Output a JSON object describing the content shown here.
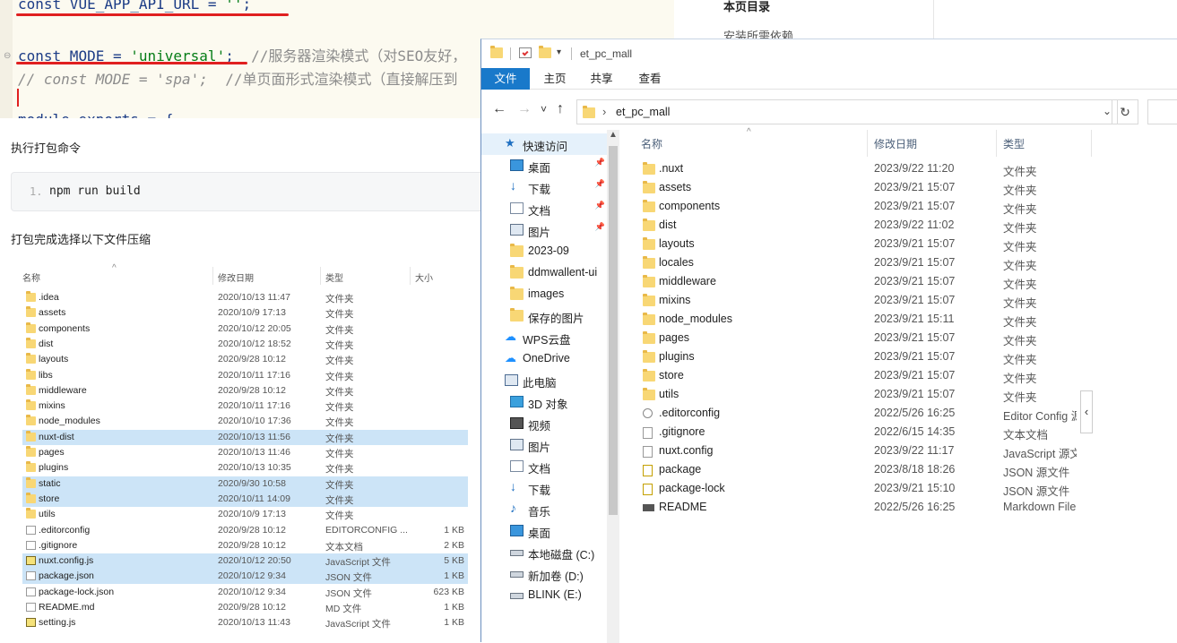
{
  "code": {
    "line1_kw": "const",
    "line1_rest": " VUE_APP_API_URL = ",
    "line1_str": "''",
    "line1_end": ";",
    "line2_kw": "const",
    "line2_rest": " MODE = ",
    "line2_str": "'universal'",
    "line2_end": ";",
    "line2_comment": "  //服务器渲染模式（对SEO友好，",
    "line3_comment": "// const MODE = 'spa';  ",
    "line3_comment2": "//单页面形式渲染模式（直接解压到",
    "line5_partial": "module.exports = {"
  },
  "doc": {
    "build_heading": "执行打包命令",
    "code_line_no": "1.",
    "code_cmd": "npm run build",
    "zip_heading": "打包完成选择以下文件压缩"
  },
  "toc": {
    "title": "本页目录",
    "item1": "安装所需依赖"
  },
  "edge_char": "选",
  "small_explorer": {
    "headers": {
      "name": "名称",
      "date": "修改日期",
      "type": "类型",
      "size": "大小"
    },
    "rows": [
      {
        "name": ".idea",
        "date": "2020/10/13 11:47",
        "type": "文件夹",
        "size": "",
        "icon": "folder",
        "selected": false
      },
      {
        "name": "assets",
        "date": "2020/10/9 17:13",
        "type": "文件夹",
        "size": "",
        "icon": "folder",
        "selected": false
      },
      {
        "name": "components",
        "date": "2020/10/12 20:05",
        "type": "文件夹",
        "size": "",
        "icon": "folder",
        "selected": false
      },
      {
        "name": "dist",
        "date": "2020/10/12 18:52",
        "type": "文件夹",
        "size": "",
        "icon": "folder",
        "selected": false
      },
      {
        "name": "layouts",
        "date": "2020/9/28 10:12",
        "type": "文件夹",
        "size": "",
        "icon": "folder",
        "selected": false
      },
      {
        "name": "libs",
        "date": "2020/10/11 17:16",
        "type": "文件夹",
        "size": "",
        "icon": "folder",
        "selected": false
      },
      {
        "name": "middleware",
        "date": "2020/9/28 10:12",
        "type": "文件夹",
        "size": "",
        "icon": "folder",
        "selected": false
      },
      {
        "name": "mixins",
        "date": "2020/10/11 17:16",
        "type": "文件夹",
        "size": "",
        "icon": "folder",
        "selected": false
      },
      {
        "name": "node_modules",
        "date": "2020/10/10 17:36",
        "type": "文件夹",
        "size": "",
        "icon": "folder",
        "selected": false
      },
      {
        "name": "nuxt-dist",
        "date": "2020/10/13 11:56",
        "type": "文件夹",
        "size": "",
        "icon": "folder",
        "selected": true
      },
      {
        "name": "pages",
        "date": "2020/10/13 11:46",
        "type": "文件夹",
        "size": "",
        "icon": "folder",
        "selected": false
      },
      {
        "name": "plugins",
        "date": "2020/10/13 10:35",
        "type": "文件夹",
        "size": "",
        "icon": "folder",
        "selected": false
      },
      {
        "name": "static",
        "date": "2020/9/30 10:58",
        "type": "文件夹",
        "size": "",
        "icon": "folder",
        "selected": true
      },
      {
        "name": "store",
        "date": "2020/10/11 14:09",
        "type": "文件夹",
        "size": "",
        "icon": "folder",
        "selected": true
      },
      {
        "name": "utils",
        "date": "2020/10/9 17:13",
        "type": "文件夹",
        "size": "",
        "icon": "folder",
        "selected": false
      },
      {
        "name": ".editorconfig",
        "date": "2020/9/28 10:12",
        "type": "EDITORCONFIG ...",
        "size": "1 KB",
        "icon": "file",
        "selected": false
      },
      {
        "name": ".gitignore",
        "date": "2020/9/28 10:12",
        "type": "文本文档",
        "size": "2 KB",
        "icon": "file",
        "selected": false
      },
      {
        "name": "nuxt.config.js",
        "date": "2020/10/12 20:50",
        "type": "JavaScript 文件",
        "size": "5 KB",
        "icon": "js",
        "selected": true
      },
      {
        "name": "package.json",
        "date": "2020/10/12 9:34",
        "type": "JSON 文件",
        "size": "1 KB",
        "icon": "file",
        "selected": true
      },
      {
        "name": "package-lock.json",
        "date": "2020/10/12 9:34",
        "type": "JSON 文件",
        "size": "623 KB",
        "icon": "file",
        "selected": false
      },
      {
        "name": "README.md",
        "date": "2020/9/28 10:12",
        "type": "MD 文件",
        "size": "1 KB",
        "icon": "file",
        "selected": false
      },
      {
        "name": "setting.js",
        "date": "2020/10/13 11:43",
        "type": "JavaScript 文件",
        "size": "1 KB",
        "icon": "js",
        "selected": false
      }
    ]
  },
  "explorer": {
    "title": "et_pc_mall",
    "ribbon_tabs": [
      "文件",
      "主页",
      "共享",
      "查看"
    ],
    "address": "et_pc_mall",
    "back_icon": "←",
    "forward_icon": "→",
    "recent_icon": "˅",
    "up_icon": "↑",
    "dropdown_icon": "⌄",
    "refresh_icon": "↻",
    "columns": {
      "name": "名称",
      "date": "修改日期",
      "type": "类型"
    },
    "sort_arrow": "^",
    "collapse_icon": "‹",
    "nav": [
      {
        "label": "快速访问",
        "icon": "star",
        "pinned": false,
        "indent": 1,
        "highlight": true
      },
      {
        "label": "桌面",
        "icon": "desktop",
        "pinned": true,
        "indent": 2,
        "highlight": false
      },
      {
        "label": "下载",
        "icon": "download",
        "pinned": true,
        "indent": 2,
        "highlight": false
      },
      {
        "label": "文档",
        "icon": "document",
        "pinned": true,
        "indent": 2,
        "highlight": false
      },
      {
        "label": "图片",
        "icon": "picture",
        "pinned": true,
        "indent": 2,
        "highlight": false
      },
      {
        "label": "2023-09",
        "icon": "folder",
        "pinned": false,
        "indent": 2,
        "highlight": false
      },
      {
        "label": "ddmwallent-ui",
        "icon": "folder",
        "pinned": false,
        "indent": 2,
        "highlight": false
      },
      {
        "label": "images",
        "icon": "folder",
        "pinned": false,
        "indent": 2,
        "highlight": false
      },
      {
        "label": "保存的图片",
        "icon": "folder",
        "pinned": false,
        "indent": 2,
        "highlight": false
      },
      {
        "label": "WPS云盘",
        "icon": "cloud",
        "pinned": false,
        "indent": 1,
        "highlight": false
      },
      {
        "label": "OneDrive",
        "icon": "cloud",
        "pinned": false,
        "indent": 1,
        "highlight": false
      },
      {
        "label": "此电脑",
        "icon": "pc",
        "pinned": false,
        "indent": 1,
        "highlight": false
      },
      {
        "label": "3D 对象",
        "icon": "cube",
        "pinned": false,
        "indent": 2,
        "highlight": false
      },
      {
        "label": "视频",
        "icon": "video",
        "pinned": false,
        "indent": 2,
        "highlight": false
      },
      {
        "label": "图片",
        "icon": "picture",
        "pinned": false,
        "indent": 2,
        "highlight": false
      },
      {
        "label": "文档",
        "icon": "document",
        "pinned": false,
        "indent": 2,
        "highlight": false
      },
      {
        "label": "下载",
        "icon": "download",
        "pinned": false,
        "indent": 2,
        "highlight": false
      },
      {
        "label": "音乐",
        "icon": "music",
        "pinned": false,
        "indent": 2,
        "highlight": false
      },
      {
        "label": "桌面",
        "icon": "desktop",
        "pinned": false,
        "indent": 2,
        "highlight": false
      },
      {
        "label": "本地磁盘 (C:)",
        "icon": "drive",
        "pinned": false,
        "indent": 2,
        "highlight": false
      },
      {
        "label": "新加卷 (D:)",
        "icon": "drive",
        "pinned": false,
        "indent": 2,
        "highlight": false
      },
      {
        "label": "BLINK (E:)",
        "icon": "drive",
        "pinned": false,
        "indent": 2,
        "highlight": false
      }
    ],
    "files": [
      {
        "name": ".nuxt",
        "date": "2023/9/22 11:20",
        "type": "文件夹",
        "icon": "folder"
      },
      {
        "name": "assets",
        "date": "2023/9/21 15:07",
        "type": "文件夹",
        "icon": "folder"
      },
      {
        "name": "components",
        "date": "2023/9/21 15:07",
        "type": "文件夹",
        "icon": "folder"
      },
      {
        "name": "dist",
        "date": "2023/9/22 11:02",
        "type": "文件夹",
        "icon": "folder"
      },
      {
        "name": "layouts",
        "date": "2023/9/21 15:07",
        "type": "文件夹",
        "icon": "folder"
      },
      {
        "name": "locales",
        "date": "2023/9/21 15:07",
        "type": "文件夹",
        "icon": "folder"
      },
      {
        "name": "middleware",
        "date": "2023/9/21 15:07",
        "type": "文件夹",
        "icon": "folder"
      },
      {
        "name": "mixins",
        "date": "2023/9/21 15:07",
        "type": "文件夹",
        "icon": "folder"
      },
      {
        "name": "node_modules",
        "date": "2023/9/21 15:11",
        "type": "文件夹",
        "icon": "folder"
      },
      {
        "name": "pages",
        "date": "2023/9/21 15:07",
        "type": "文件夹",
        "icon": "folder"
      },
      {
        "name": "plugins",
        "date": "2023/9/21 15:07",
        "type": "文件夹",
        "icon": "folder"
      },
      {
        "name": "store",
        "date": "2023/9/21 15:07",
        "type": "文件夹",
        "icon": "folder"
      },
      {
        "name": "utils",
        "date": "2023/9/21 15:07",
        "type": "文件夹",
        "icon": "folder"
      },
      {
        "name": ".editorconfig",
        "date": "2022/5/26 16:25",
        "type": "Editor Config 源文件",
        "icon": "gear"
      },
      {
        "name": ".gitignore",
        "date": "2022/6/15 14:35",
        "type": "文本文档",
        "icon": "text"
      },
      {
        "name": "nuxt.config",
        "date": "2023/9/22 11:17",
        "type": "JavaScript 源文件",
        "icon": "js"
      },
      {
        "name": "package",
        "date": "2023/8/18 18:26",
        "type": "JSON 源文件",
        "icon": "json"
      },
      {
        "name": "package-lock",
        "date": "2023/9/21 15:10",
        "type": "JSON 源文件",
        "icon": "json"
      },
      {
        "name": "README",
        "date": "2022/5/26 16:25",
        "type": "Markdown File",
        "icon": "md"
      }
    ]
  },
  "colors": {
    "accent": "#1979ca",
    "selection": "#cce4f7",
    "nav_highlight": "#e5f1fb",
    "folder": "#f8d775",
    "red_underline": "#e02020"
  }
}
